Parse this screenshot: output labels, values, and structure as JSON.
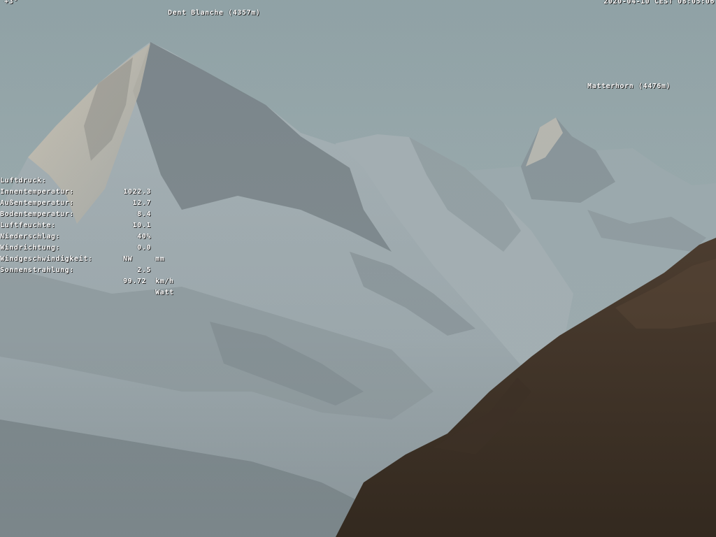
{
  "overlay": {
    "outside_temp": "+3°",
    "timestamp": "2020-04-10 CEST 08:05:06",
    "peaks": [
      {
        "name": "Dent Blanche (4357m)"
      },
      {
        "name": "Matterhorn (4476m)"
      }
    ]
  },
  "weather": {
    "rows": [
      {
        "label": "Luftdruck:",
        "value": "1022.3",
        "unit": ""
      },
      {
        "label": "Innentemperatur:",
        "value": "12.7",
        "unit": ""
      },
      {
        "label": "Außentemperatur:",
        "value": "8.4",
        "unit": ""
      },
      {
        "label": "Bodentemperatur:",
        "value": "10.1",
        "unit": ""
      },
      {
        "label": "Luftfeuchte:",
        "value": "40%",
        "unit": ""
      },
      {
        "label": "Niederschlag:",
        "value": "0.0",
        "unit": "mm"
      },
      {
        "label": "Windrichtung:",
        "value": "NW",
        "unit": ""
      },
      {
        "label": "Windgeschwindigkeit:",
        "value": "2.5",
        "unit": "km/h"
      },
      {
        "label": "Sonnenstrahlung:",
        "value": "99.72",
        "unit": "Watt"
      }
    ]
  },
  "colors": {
    "sky": "#8fa3a6",
    "snow": "#b5bcc0",
    "rock": "#6a7378",
    "forest": "#4a3a2c",
    "text": "#ffffff"
  }
}
